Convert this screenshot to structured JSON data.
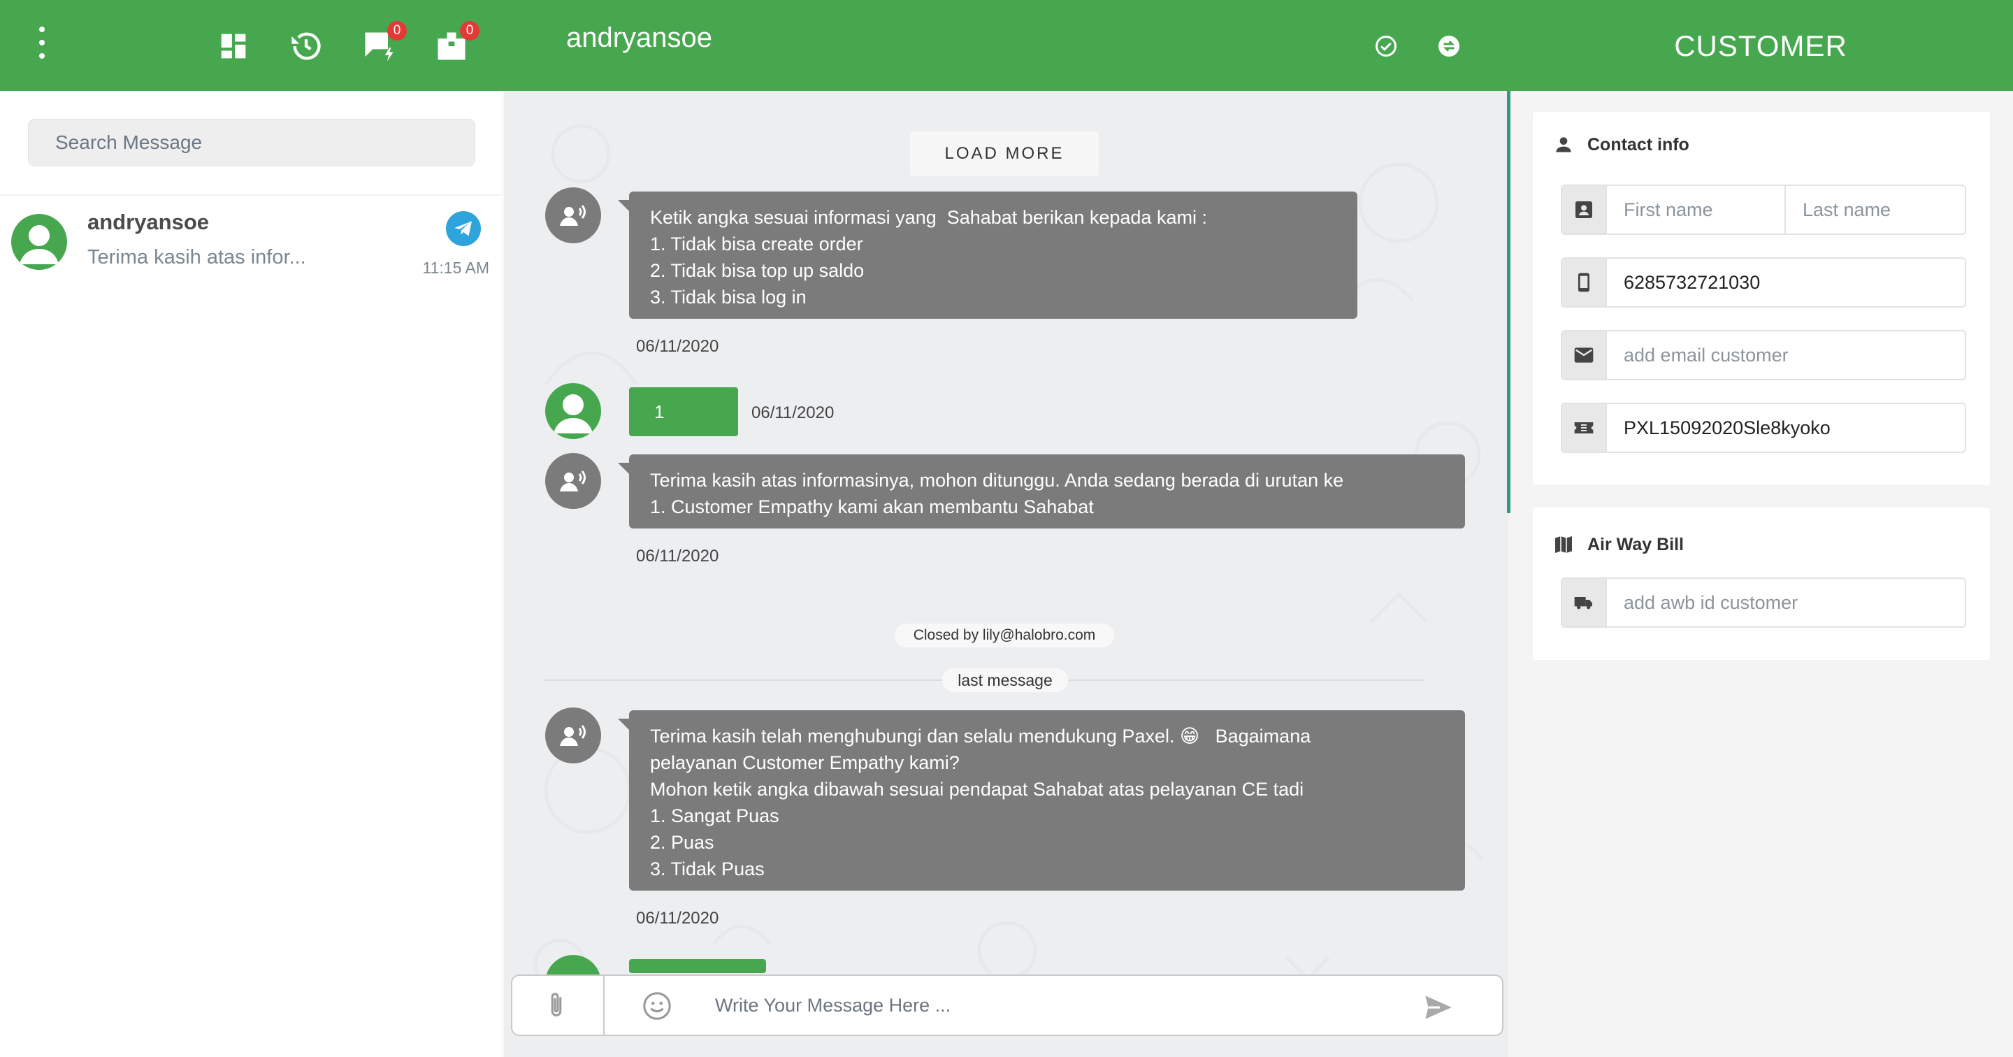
{
  "header": {
    "chat_title": "andryansoe",
    "panel_title": "CUSTOMER",
    "badges": {
      "chats": "0",
      "tickets": "0"
    },
    "icons": [
      "menu-dots-icon",
      "dashboard-icon",
      "history-icon",
      "chat-flash-icon",
      "ticket-icon",
      "check-circle-icon",
      "transfer-icon"
    ]
  },
  "sidebar": {
    "search_placeholder": "Search Message",
    "conversations": [
      {
        "name": "andryansoe",
        "preview": "Terima kasih atas infor...",
        "time": "11:15 AM",
        "channel_icon": "telegram-icon"
      }
    ]
  },
  "chat": {
    "load_more": "LOAD MORE",
    "messages": [
      {
        "from": "bot",
        "lines": [
          "Ketik angka sesuai informasi yang  Sahabat berikan kepada kami :",
          "1. Tidak bisa create order",
          "2. Tidak bisa top up saldo",
          "3. Tidak bisa log in"
        ],
        "date": "06/11/2020"
      },
      {
        "from": "user",
        "text": "1",
        "date": "06/11/2020"
      },
      {
        "from": "bot",
        "lines": [
          "Terima kasih atas informasinya, mohon ditunggu. Anda sedang berada di urutan ke",
          "1. Customer Empathy kami akan membantu Sahabat"
        ],
        "date": "06/11/2020"
      },
      {
        "from": "bot",
        "lines": [
          "Terima kasih telah menghubungi dan selalu mendukung Paxel. 😁   Bagaimana",
          "pelayanan Customer Empathy kami?",
          "Mohon ketik angka dibawah sesuai pendapat Sahabat atas pelayanan CE tadi",
          "1. Sangat Puas",
          "2. Puas",
          "3. Tidak Puas"
        ],
        "date": "06/11/2020"
      }
    ],
    "closed_by": "Closed by lily@halobro.com",
    "last_message": "last message",
    "composer_placeholder": "Write Your Message Here ..."
  },
  "customer": {
    "contact_title": "Contact info",
    "first_name_placeholder": "First name",
    "last_name_placeholder": "Last name",
    "phone": "6285732721030",
    "email_placeholder": "add email customer",
    "ticket_id": "PXL15092020Sle8kyoko",
    "awb_title": "Air Way Bill",
    "awb_placeholder": "add awb id customer"
  },
  "colors": {
    "brand_green": "#46a74e",
    "bubble_grey": "#7b7b7b",
    "badge_red": "#e53935",
    "telegram_blue": "#2fa3dc",
    "teal_accent": "#2f9b85"
  }
}
